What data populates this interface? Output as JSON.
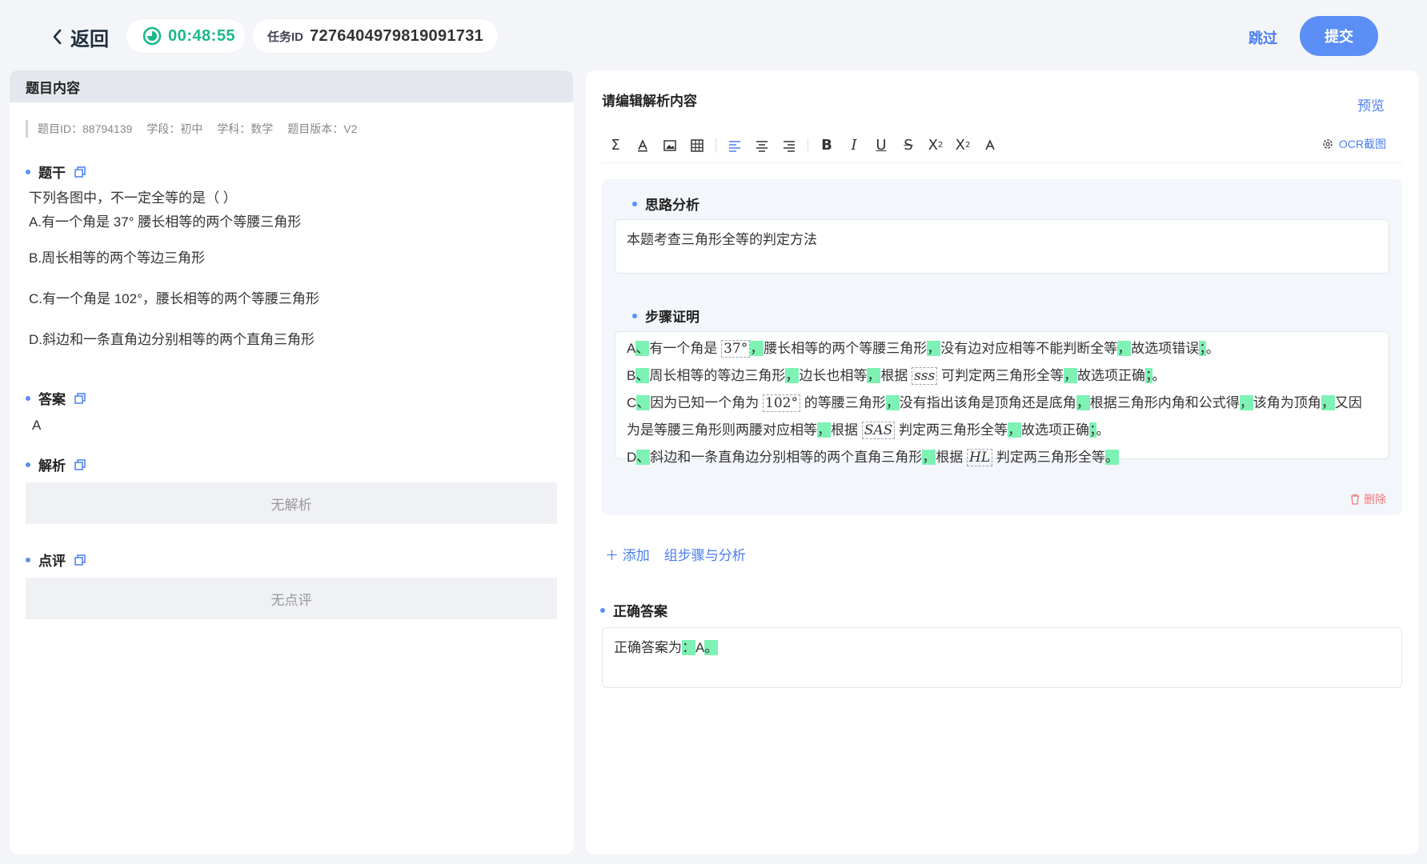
{
  "topbar": {
    "back_label": "返回",
    "timer": "00:48:55",
    "task_label": "任务ID",
    "task_id": "7276404979819091731",
    "skip_label": "跳过",
    "submit_label": "提交"
  },
  "left": {
    "header": "题目内容",
    "meta": {
      "id": "题目ID：88794139",
      "stage": "学段：初中",
      "subject": "学科：数学",
      "version": "题目版本：V2"
    },
    "stem": {
      "title": "题干",
      "question": "下列各图中，不一定全等的是（  ）",
      "options": [
        "A.有一个角是 37° 腰长相等的两个等腰三角形",
        "B.周长相等的两个等边三角形",
        "C.有一个角是 102°，腰长相等的两个等腰三角形",
        "D.斜边和一条直角边分别相等的两个直角三角形"
      ]
    },
    "answer": {
      "title": "答案",
      "value": "A"
    },
    "analysis": {
      "title": "解析",
      "empty": "无解析"
    },
    "comment": {
      "title": "点评",
      "empty": "无点评"
    }
  },
  "right": {
    "title": "请编辑解析内容",
    "preview": "预览",
    "ocr": "OCR截图",
    "toolbar_icons": [
      "sigma-icon",
      "highlight-icon",
      "image-icon",
      "table-icon",
      "align-left-icon",
      "align-center-icon",
      "align-right-icon",
      "bold-icon",
      "italic-icon",
      "underline-icon",
      "strikethrough-icon",
      "superscript-icon",
      "subscript-icon",
      "font-color-icon"
    ],
    "thinking": {
      "title": "思路分析",
      "text": "本题考查三角形全等的判定方法"
    },
    "steps": {
      "title": "步骤证明",
      "a": {
        "p1": "A",
        "p2": "、",
        "p3": "有一个角是",
        "m1": "37°",
        "p4": "，",
        "p5": "腰长相等的两个等腰三角形",
        "p6": "，",
        "p7": "没有边对应相等不能判断全等",
        "p8": "，",
        "p9": "故选项错误",
        "p10": "；",
        "p11": "。"
      },
      "b": {
        "p1": "B",
        "p2": "、",
        "p3": "周长相等的等边三角形",
        "p4": "，",
        "p5": "边长也相等",
        "p6": "，",
        "p7": "根据",
        "m1": "sss",
        "p8": "可判定两三角形全等",
        "p9": "，",
        "p10": "故选项正确",
        "p11": "；",
        "p12": "。"
      },
      "c1": {
        "p1": "C",
        "p2": "、",
        "p3": "因为已知一个角为",
        "m1": "102°",
        "p4": "的等腰三角形",
        "p5": "，",
        "p6": "没有指出该角是顶角还是底角",
        "p7": "，",
        "p8": "根据三角形内角和公式得",
        "p9": "，",
        "p10": "该角为顶角",
        "p11": "，",
        "p12": "又因"
      },
      "c2": {
        "p1": "为是等腰三角形则两腰对应相等",
        "p2": "，",
        "p3": "根据",
        "m1": "SAS",
        "p4": "判定两三角形全等",
        "p5": "，",
        "p6": "故选项正确",
        "p7": "；",
        "p8": "。"
      },
      "d": {
        "p1": "D",
        "p2": "、",
        "p3": "斜边和一条直角边分别相等的两个直角三角形",
        "p4": "，",
        "p5": "根据",
        "m1": "HL",
        "p6": "判定两三角形全等",
        "p7": "。"
      }
    },
    "delete": "删除",
    "add": "添加",
    "group": "组步骤与分析",
    "answer": {
      "title": "正确答案",
      "p1": "正确答案为",
      "p2": "：",
      "p3": "A",
      "p4": "。"
    }
  },
  "colors": {
    "accent": "#5b8ff5",
    "timer": "#19b98a",
    "highlight": "#7ef2b5",
    "danger": "#f07a7a"
  }
}
